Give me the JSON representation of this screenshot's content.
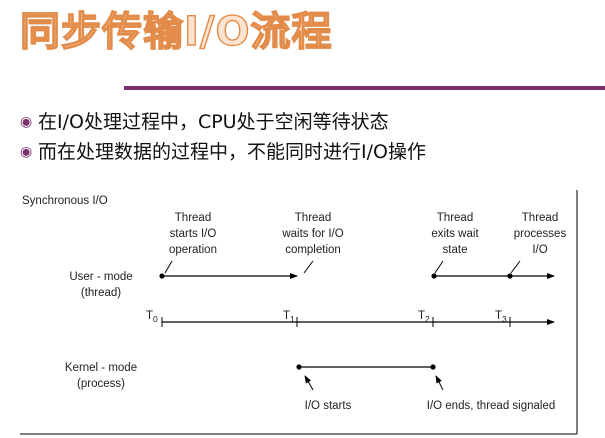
{
  "title": "同步传输I/O流程",
  "bullets": [
    "在I/O处理过程中，CPU处于空闲等待状态",
    "而在处理数据的过程中，不能同时进行I/O操作"
  ],
  "diagram": {
    "caption": "Synchronous I/O",
    "user_label": [
      "User - mode",
      "(thread)"
    ],
    "kernel_label": [
      "Kernel - mode",
      "(process)"
    ],
    "time_markers": [
      {
        "base": "T",
        "sub": "0"
      },
      {
        "base": "T",
        "sub": "1"
      },
      {
        "base": "T",
        "sub": "2"
      },
      {
        "base": "T",
        "sub": "3"
      }
    ],
    "thread_events": [
      [
        "Thread",
        "starts I/O",
        "operation"
      ],
      [
        "Thread",
        "waits for I/O",
        "completion"
      ],
      [
        "Thread",
        "exits wait",
        "state"
      ],
      [
        "Thread",
        "processes",
        "I/O"
      ]
    ],
    "kernel_events": [
      "I/O starts",
      "I/O ends, thread signaled"
    ]
  }
}
